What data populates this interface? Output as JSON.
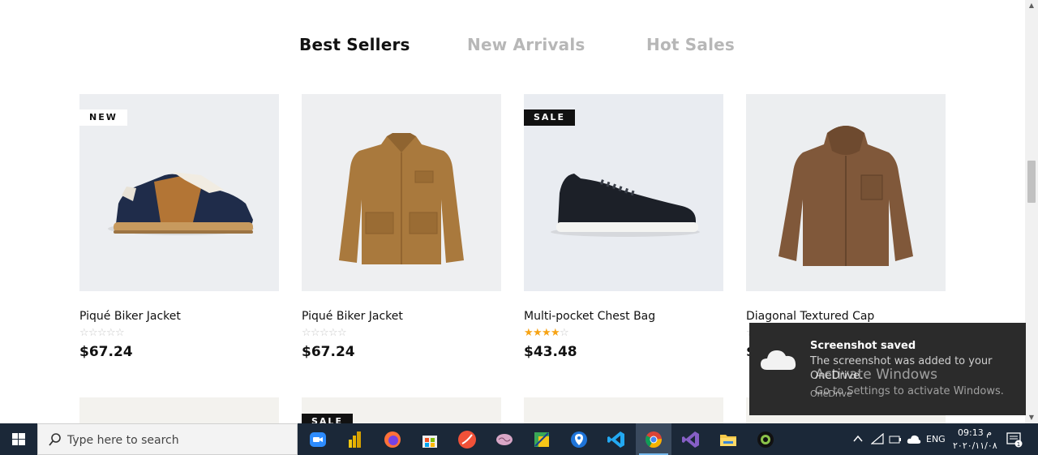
{
  "tabs": [
    {
      "label": "Best Sellers",
      "active": true
    },
    {
      "label": "New Arrivals",
      "active": false
    },
    {
      "label": "Hot Sales",
      "active": false
    }
  ],
  "products": [
    {
      "name": "Piqué Biker Jacket",
      "price": "$67.24",
      "badge": "NEW",
      "rating": 0,
      "image": "sneaker-blue-icon"
    },
    {
      "name": "Piqué Biker Jacket",
      "price": "$67.24",
      "badge": "",
      "rating": 0,
      "image": "jacket-tan-icon"
    },
    {
      "name": "Multi-pocket Chest Bag",
      "price": "$43.48",
      "badge": "SALE",
      "rating": 4,
      "image": "sneaker-black-icon"
    },
    {
      "name": "Diagonal Textured Cap",
      "price": "$",
      "badge": "",
      "rating": 0,
      "image": "hoodie-brown-icon"
    }
  ],
  "second_row": {
    "badge": "SALE"
  },
  "notification": {
    "title": "Screenshot saved",
    "body": "The screenshot was added to your OneDrive.",
    "source": "OneDrive",
    "watermark_title": "Activate Windows",
    "watermark_body": "Go to Settings to activate Windows."
  },
  "taskbar": {
    "search_placeholder": "Type here to search",
    "language": "ENG",
    "time": "09:13 م",
    "date": "٢٠٢٠/١١/٠٨",
    "apps": [
      "zoom-icon",
      "powerbi-icon",
      "firefox-icon",
      "store-icon",
      "swift-icon",
      "brain-icon",
      "photo-editor-icon",
      "maps-icon",
      "vscode-icon",
      "chrome-icon",
      "visual-studio-icon",
      "file-explorer-icon",
      "camera-app-icon"
    ]
  },
  "colors": {
    "accent": "#111111",
    "inactive_tab": "#b7b7b7",
    "star": "#f7a416",
    "card_bg": "#f3f2ee",
    "taskbar": "#1b2838"
  }
}
